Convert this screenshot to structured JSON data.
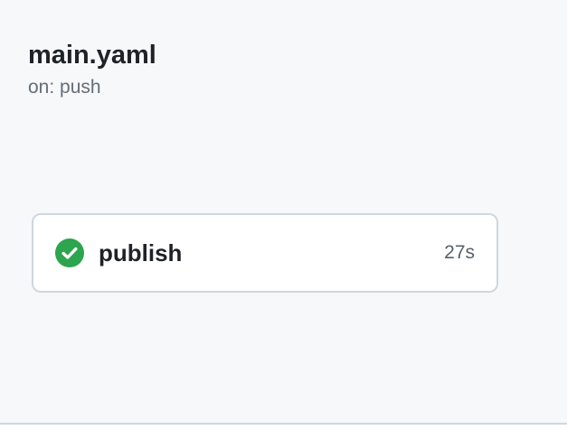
{
  "workflow": {
    "title": "main.yaml",
    "trigger": "on: push"
  },
  "jobs": [
    {
      "name": "publish",
      "duration": "27s",
      "status": "success",
      "status_icon": "check-circle-icon"
    }
  ],
  "colors": {
    "background": "#f6f8fa",
    "success": "#2da44e",
    "text_primary": "#1f2328",
    "text_secondary": "#656d76",
    "border": "#d0d7de"
  }
}
